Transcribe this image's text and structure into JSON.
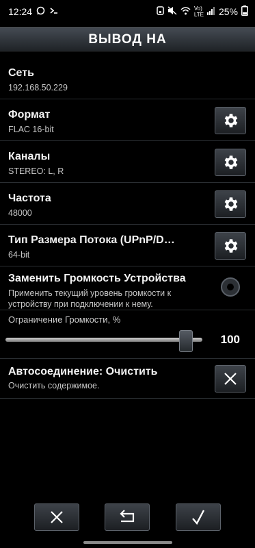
{
  "status_bar": {
    "time": "12:24",
    "volte": "Vo)\nLTE",
    "battery": "25%",
    "left_icons": [
      "whatsapp-icon",
      "terminal-icon"
    ],
    "right_icons": [
      "alarm-icon",
      "mute-icon",
      "wifi-icon",
      "signal-icon",
      "battery-icon"
    ]
  },
  "header": {
    "title": "ВЫВОД НА"
  },
  "settings": [
    {
      "label": "Сеть",
      "value": "192.168.50.229",
      "control": "none"
    },
    {
      "label": "Формат",
      "value": "FLAC 16-bit",
      "control": "gear"
    },
    {
      "label": "Каналы",
      "value": "STEREO: L, R",
      "control": "gear"
    },
    {
      "label": "Частота",
      "value": "48000",
      "control": "gear"
    },
    {
      "label": "Тип Размера Потока (UPnP/D…",
      "value": "64-bit",
      "control": "gear"
    }
  ],
  "replace_volume": {
    "label": "Заменить Громкость Устройства",
    "description": "Применить текущий уровень громкости к устройству при подключении к нему.",
    "checked": false
  },
  "volume_limit": {
    "label": "Ограничение Громкости, %",
    "value": "100",
    "fraction": 1.0
  },
  "auto_connect": {
    "label": "Автосоединение: Очистить",
    "description": "Очистить содержимое."
  },
  "footer": {
    "buttons": [
      "cancel",
      "undo",
      "confirm"
    ]
  }
}
